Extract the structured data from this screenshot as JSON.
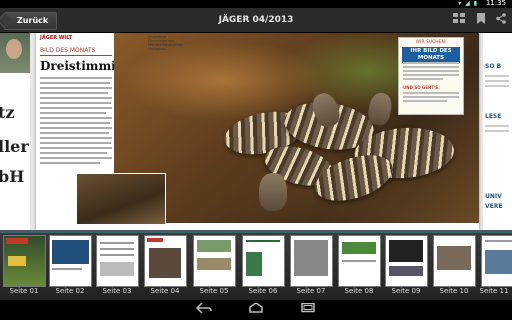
{
  "status_bar": {
    "time": "11:35",
    "icons": "▾ ◢ ▮"
  },
  "action_bar": {
    "back_label": "Zurück",
    "title": "JÄGER 04/2013",
    "icons": [
      "grid-view-icon",
      "bookmark-icon",
      "share-icon"
    ]
  },
  "page": {
    "brand": "JÄGER WILT",
    "section_kicker": "BILD DES MONATS",
    "headline": "Dreistimmig",
    "photo_caption": "Ungefähre Frischlingsrotte, Waldwildbeobachter Hochmoor ...",
    "promo": {
      "top": "WIR SUCHEN:",
      "banner": "IHR BILD DES MONATS",
      "sub": "UND SO GEHT'S:"
    },
    "left_edge_text": [
      "tz",
      "ller",
      "bH"
    ],
    "right_edge_labels": [
      "SO B",
      "LESE",
      "UNIV",
      "VERE"
    ]
  },
  "thumbnails": [
    {
      "label": "Seite 01"
    },
    {
      "label": "Seite 02"
    },
    {
      "label": "Seite 03"
    },
    {
      "label": "Seite 04"
    },
    {
      "label": "Seite 05"
    },
    {
      "label": "Seite 06"
    },
    {
      "label": "Seite 07"
    },
    {
      "label": "Seite 08"
    },
    {
      "label": "Seite 09"
    },
    {
      "label": "Seite 10"
    },
    {
      "label": "Seite 11"
    }
  ],
  "nav_bar": {
    "icons": [
      "back-nav-icon",
      "home-nav-icon",
      "recent-apps-icon"
    ]
  },
  "colors": {
    "accent": "#33b5e5",
    "brand_red": "#c0392b",
    "promo_blue": "#1f5e9c"
  }
}
